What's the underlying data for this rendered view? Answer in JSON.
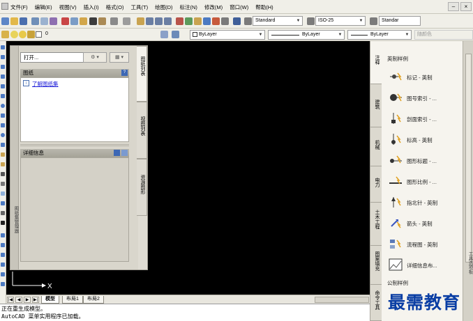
{
  "menubar": {
    "items": [
      "文件(F)",
      "编辑(E)",
      "视图(V)",
      "插入(I)",
      "格式(O)",
      "工具(T)",
      "绘图(D)",
      "标注(N)",
      "修改(M)",
      "窗口(W)",
      "帮助(H)"
    ],
    "window_controls": [
      "–",
      "×"
    ]
  },
  "toolbar": {
    "text_style": "Standard",
    "dim_style": "ISO-25",
    "table_style": "Standar",
    "layer": "0",
    "color": "ByLayer",
    "linetype": "ByLayer",
    "lineweight": "ByLayer",
    "plot_style": "随颜色"
  },
  "sheetset": {
    "open_label": "打开...",
    "drawings_header": "图纸",
    "learn_link": "了解图纸集",
    "details_header": "详细信息",
    "tabs": [
      "图纸列表",
      "视图列表",
      "资源图形"
    ],
    "side_title": "图纸集管理器"
  },
  "toolpalette": {
    "section1": "英制样例",
    "items": [
      "标记 - 英制",
      "图号索引 - ...",
      "剖面索引 - ...",
      "标高 - 英制",
      "图形标题 - ...",
      "图形比例 - ...",
      "指北针 - 英制",
      "箭头 - 英制",
      "流程图 - 英制",
      "详细信息布..."
    ],
    "section2": "公制样例",
    "tabs": [
      "注释",
      "建筑",
      "机械",
      "电力",
      "土木工程",
      "图案填充",
      "命令工具"
    ],
    "side_title": "工具选项板"
  },
  "layout_tabs": [
    "模型",
    "布局1",
    "布局2"
  ],
  "nav_buttons": [
    "|◀",
    "◀",
    "▶",
    "▶|"
  ],
  "ucs": {
    "x_label": "X"
  },
  "command": {
    "line1": "正在重生成模型。",
    "line2": "AutoCAD 菜单实用程序已加载。"
  },
  "watermark": "最需教育",
  "colors": {
    "canvas": "#000000",
    "link": "#1a1ad8",
    "watermark": "#0a3ea4"
  }
}
